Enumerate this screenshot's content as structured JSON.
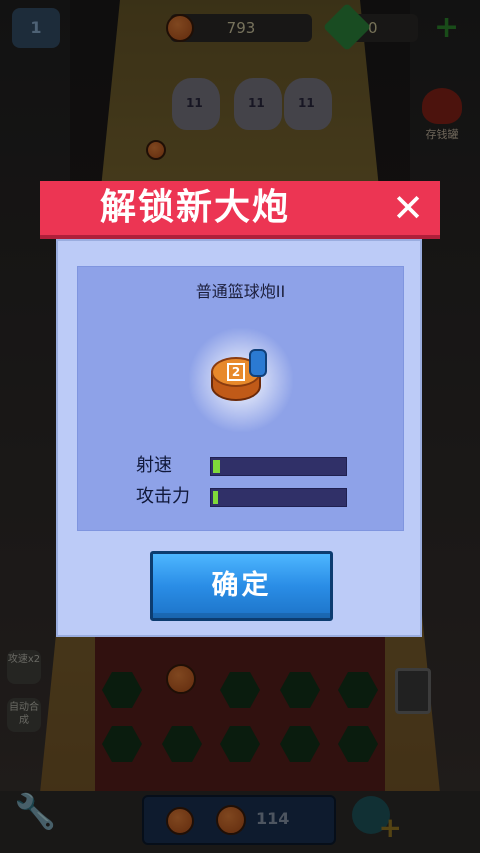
{
  "hud": {
    "level": "1",
    "coins": "793",
    "gems": "0",
    "bank_label": "存钱罐",
    "player_number": "11"
  },
  "side_buttons": [
    {
      "label": "攻速x2"
    },
    {
      "label": "自动合成"
    }
  ],
  "bottom": {
    "buy_price": "114"
  },
  "modal": {
    "title": "解锁新大炮",
    "close_label": "✕",
    "cannon_name": "普通篮球炮II",
    "cannon_mark": "2",
    "stats": [
      {
        "label": "射速",
        "level": 0.05
      },
      {
        "label": "攻击力",
        "level": 0.02
      }
    ],
    "confirm_label": "确定"
  },
  "colors": {
    "header": "#ec3553",
    "body": "#bccbf7",
    "panel": "#8ea2e8",
    "stat_bar": "#303068",
    "stat_fill": "#7fd93a",
    "confirm": "#2a8de6"
  }
}
